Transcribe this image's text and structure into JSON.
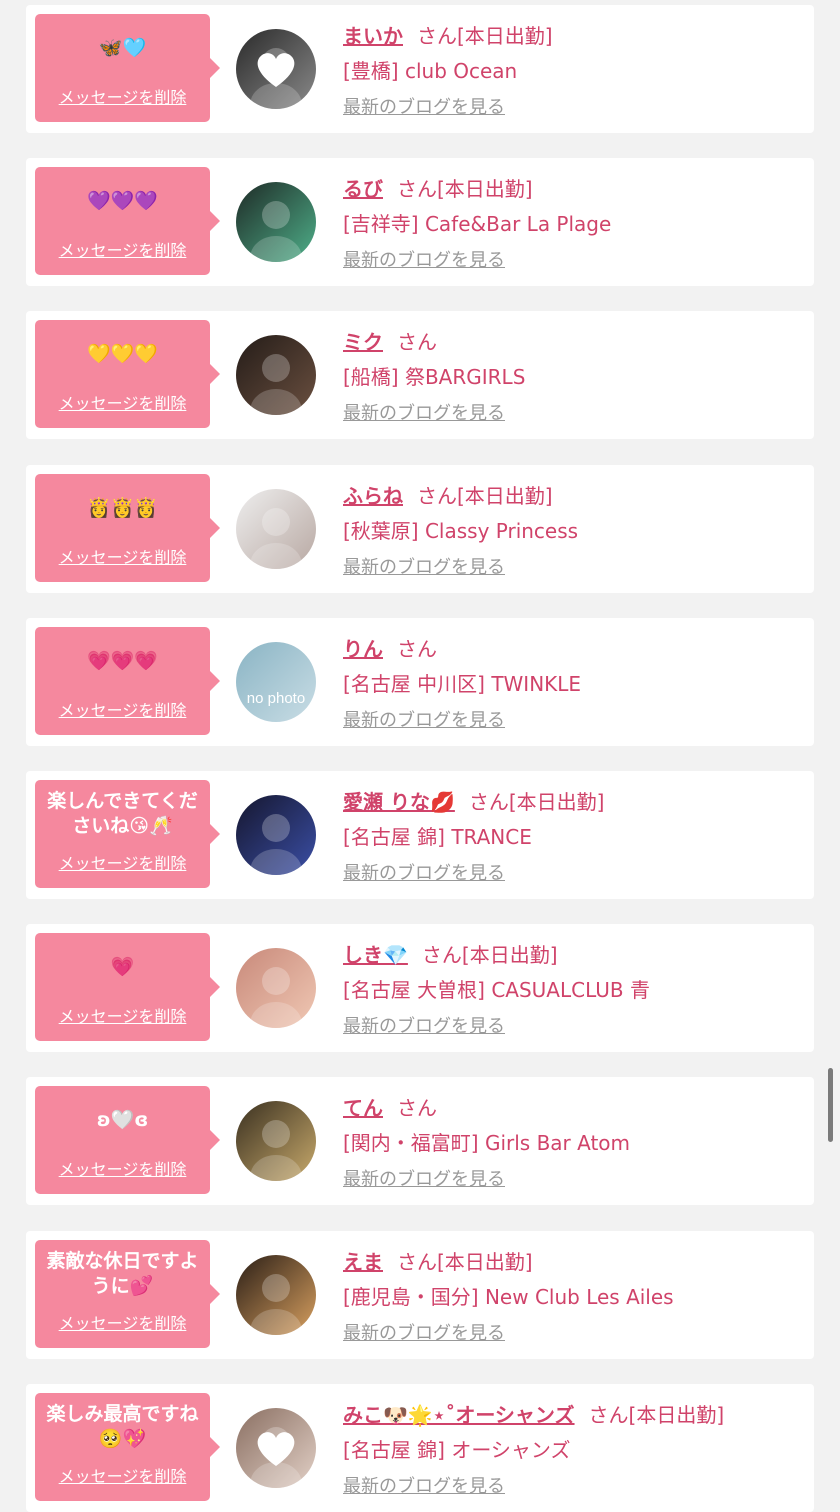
{
  "delete_label": "メッセージを削除",
  "blog_label": "最新のブログを見る",
  "san_label": "さん",
  "colors": {
    "accent": "#d0436a",
    "bubble": "#f5889e",
    "link_gray": "#999999",
    "background": "#f2f2f2"
  },
  "items": [
    {
      "message": "🦋🩵",
      "name": "まいか",
      "status": "[本日出勤]",
      "shop": "[豊橋] club Ocean",
      "avatar_icon": "white-heart-sticker-photo",
      "avatar_colors": [
        "#2a2a2a",
        "#8a8a8a"
      ],
      "avatar_overlay": "heart"
    },
    {
      "message": "💜💜💜",
      "name": "るび",
      "status": "[本日出勤]",
      "shop": "[吉祥寺] Cafe&Bar La Plage",
      "avatar_icon": "green-hair-person-photo",
      "avatar_colors": [
        "#1e2a26",
        "#4fb08a"
      ],
      "avatar_overlay": "none"
    },
    {
      "message": "💛💛💛",
      "name": "ミク",
      "status": "",
      "shop": "[船橋] 祭BARGIRLS",
      "avatar_icon": "person-photo",
      "avatar_colors": [
        "#241c18",
        "#6b5040"
      ],
      "avatar_overlay": "none"
    },
    {
      "message": "👸👸👸",
      "name": "ふらね",
      "status": "[本日出勤]",
      "shop": "[秋葉原] Classy Princess",
      "avatar_icon": "person-photo",
      "avatar_colors": [
        "#eeeeee",
        "#b8a8a2"
      ],
      "avatar_overlay": "none"
    },
    {
      "message": "💗💗💗",
      "name": "りん",
      "status": "",
      "shop": "[名古屋 中川区] TWINKLE",
      "avatar_icon": "no-photo-placeholder",
      "avatar_colors": [
        "#8ab4c4",
        "#c9dde5"
      ],
      "avatar_overlay": "text",
      "avatar_text": "no photo"
    },
    {
      "message": "楽しんできてくださいね😘🥂",
      "name": "愛瀬 りな💋",
      "status": "[本日出勤]",
      "shop": "[名古屋 錦] TRANCE",
      "avatar_icon": "person-photo",
      "avatar_colors": [
        "#15162e",
        "#3b4fa6"
      ],
      "avatar_overlay": "none"
    },
    {
      "message": "💗",
      "name": "しき💎",
      "status": "[本日出勤]",
      "shop": "[名古屋 大曽根] CASUALCLUB 青",
      "avatar_icon": "person-photo",
      "avatar_colors": [
        "#c8897a",
        "#f0c8b4"
      ],
      "avatar_overlay": "none"
    },
    {
      "message": "ʚ🤍ɞ",
      "name": "てん",
      "status": "",
      "shop": "[関内・福富町] Girls Bar Atom",
      "avatar_icon": "person-photo",
      "avatar_colors": [
        "#3a3020",
        "#c8aa6c"
      ],
      "avatar_overlay": "none"
    },
    {
      "message": "素敵な休日ですように💕",
      "name": "えま",
      "status": "[本日出勤]",
      "shop": "[鹿児島・国分] New Club Les Ailes",
      "avatar_icon": "person-photo",
      "avatar_colors": [
        "#2a1e16",
        "#d8a060"
      ],
      "avatar_overlay": "none"
    },
    {
      "message": "楽しみ最高ですね🥺💖",
      "name": "みこ🐶🌟⋆˚オーシャンズ",
      "status": "[本日出勤]",
      "shop": "[名古屋 錦] オーシャンズ",
      "avatar_icon": "white-heart-sticker-photo",
      "avatar_colors": [
        "#8a6f62",
        "#e2d0c6"
      ],
      "avatar_overlay": "heart"
    }
  ]
}
